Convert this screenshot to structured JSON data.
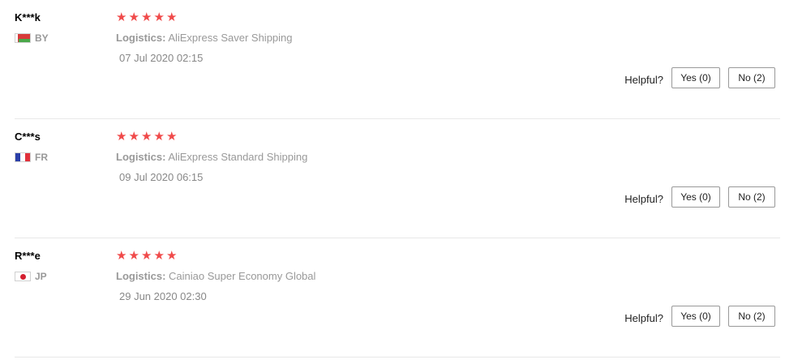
{
  "reviews": [
    {
      "user": "K***k",
      "country_code": "BY",
      "flag": "flag-belarus-icon",
      "rating": 5,
      "logistics_label": "Logistics:",
      "logistics_value": "AliExpress Saver Shipping",
      "date": "07 Jul 2020 02:15",
      "helpful_label": "Helpful?",
      "yes_label": "Yes (0)",
      "no_label": "No (2)"
    },
    {
      "user": "C***s",
      "country_code": "FR",
      "flag": "flag-france-icon",
      "rating": 5,
      "logistics_label": "Logistics:",
      "logistics_value": "AliExpress Standard Shipping",
      "date": "09 Jul 2020 06:15",
      "helpful_label": "Helpful?",
      "yes_label": "Yes (0)",
      "no_label": "No (2)"
    },
    {
      "user": "R***e",
      "country_code": "JP",
      "flag": "flag-japan-icon",
      "rating": 5,
      "logistics_label": "Logistics:",
      "logistics_value": "Cainiao Super Economy Global",
      "date": "29 Jun 2020 02:30",
      "helpful_label": "Helpful?",
      "yes_label": "Yes (0)",
      "no_label": "No (2)"
    }
  ],
  "colors": {
    "star": "#f04a4a",
    "divider": "#e8e8e8"
  }
}
